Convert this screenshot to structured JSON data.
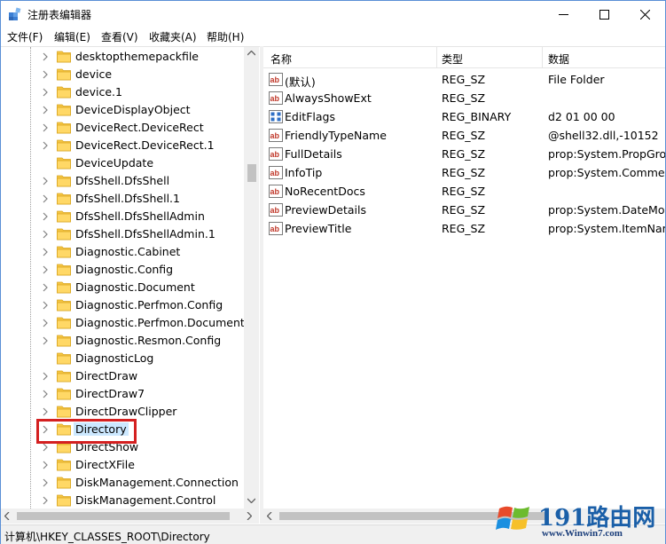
{
  "window": {
    "title": "注册表编辑器",
    "controls": [
      "minimize",
      "maximize",
      "close"
    ]
  },
  "menu": [
    {
      "label": "文件(F)"
    },
    {
      "label": "编辑(E)"
    },
    {
      "label": "查看(V)"
    },
    {
      "label": "收藏夹(A)"
    },
    {
      "label": "帮助(H)"
    }
  ],
  "tree": {
    "items": [
      {
        "label": "desktopthemepackfile",
        "expandable": true
      },
      {
        "label": "device",
        "expandable": true
      },
      {
        "label": "device.1",
        "expandable": true
      },
      {
        "label": "DeviceDisplayObject",
        "expandable": true
      },
      {
        "label": "DeviceRect.DeviceRect",
        "expandable": true
      },
      {
        "label": "DeviceRect.DeviceRect.1",
        "expandable": true
      },
      {
        "label": "DeviceUpdate",
        "expandable": false
      },
      {
        "label": "DfsShell.DfsShell",
        "expandable": true
      },
      {
        "label": "DfsShell.DfsShell.1",
        "expandable": true
      },
      {
        "label": "DfsShell.DfsShellAdmin",
        "expandable": true
      },
      {
        "label": "DfsShell.DfsShellAdmin.1",
        "expandable": true
      },
      {
        "label": "Diagnostic.Cabinet",
        "expandable": true
      },
      {
        "label": "Diagnostic.Config",
        "expandable": true
      },
      {
        "label": "Diagnostic.Document",
        "expandable": true
      },
      {
        "label": "Diagnostic.Perfmon.Config",
        "expandable": true
      },
      {
        "label": "Diagnostic.Perfmon.Document",
        "expandable": true
      },
      {
        "label": "Diagnostic.Resmon.Config",
        "expandable": true
      },
      {
        "label": "DiagnosticLog",
        "expandable": false
      },
      {
        "label": "DirectDraw",
        "expandable": true
      },
      {
        "label": "DirectDraw7",
        "expandable": true
      },
      {
        "label": "DirectDrawClipper",
        "expandable": true
      },
      {
        "label": "Directory",
        "expandable": true,
        "selected": true
      },
      {
        "label": "DirectShow",
        "expandable": true
      },
      {
        "label": "DirectXFile",
        "expandable": true
      },
      {
        "label": "DiskManagement.Connection",
        "expandable": true
      },
      {
        "label": "DiskManagement.Control",
        "expandable": true
      }
    ]
  },
  "list": {
    "columns": [
      "名称",
      "类型",
      "数据"
    ],
    "rows": [
      {
        "name": "(默认)",
        "type": "REG_SZ",
        "data": "File Folder",
        "icon": "string-value-icon"
      },
      {
        "name": "AlwaysShowExt",
        "type": "REG_SZ",
        "data": "",
        "icon": "string-value-icon"
      },
      {
        "name": "EditFlags",
        "type": "REG_BINARY",
        "data": "d2 01 00 00",
        "icon": "binary-value-icon"
      },
      {
        "name": "FriendlyTypeName",
        "type": "REG_SZ",
        "data": "@shell32.dll,-10152",
        "icon": "string-value-icon"
      },
      {
        "name": "FullDetails",
        "type": "REG_SZ",
        "data": "prop:System.PropGrou",
        "icon": "string-value-icon"
      },
      {
        "name": "InfoTip",
        "type": "REG_SZ",
        "data": "prop:System.Comment",
        "icon": "string-value-icon"
      },
      {
        "name": "NoRecentDocs",
        "type": "REG_SZ",
        "data": "",
        "icon": "string-value-icon"
      },
      {
        "name": "PreviewDetails",
        "type": "REG_SZ",
        "data": "prop:System.DateMod",
        "icon": "string-value-icon"
      },
      {
        "name": "PreviewTitle",
        "type": "REG_SZ",
        "data": "prop:System.ItemNam",
        "icon": "string-value-icon"
      }
    ]
  },
  "status": {
    "path": "计算机\\HKEY_CLASSES_ROOT\\Directory"
  },
  "watermark": {
    "brand": "191路由网",
    "site": "www.Winwin7.com"
  },
  "colors": {
    "selection": "#cce8ff",
    "highlight_box": "#d42020",
    "folder": "#f5c542",
    "window_border": "#5a8fd6"
  }
}
